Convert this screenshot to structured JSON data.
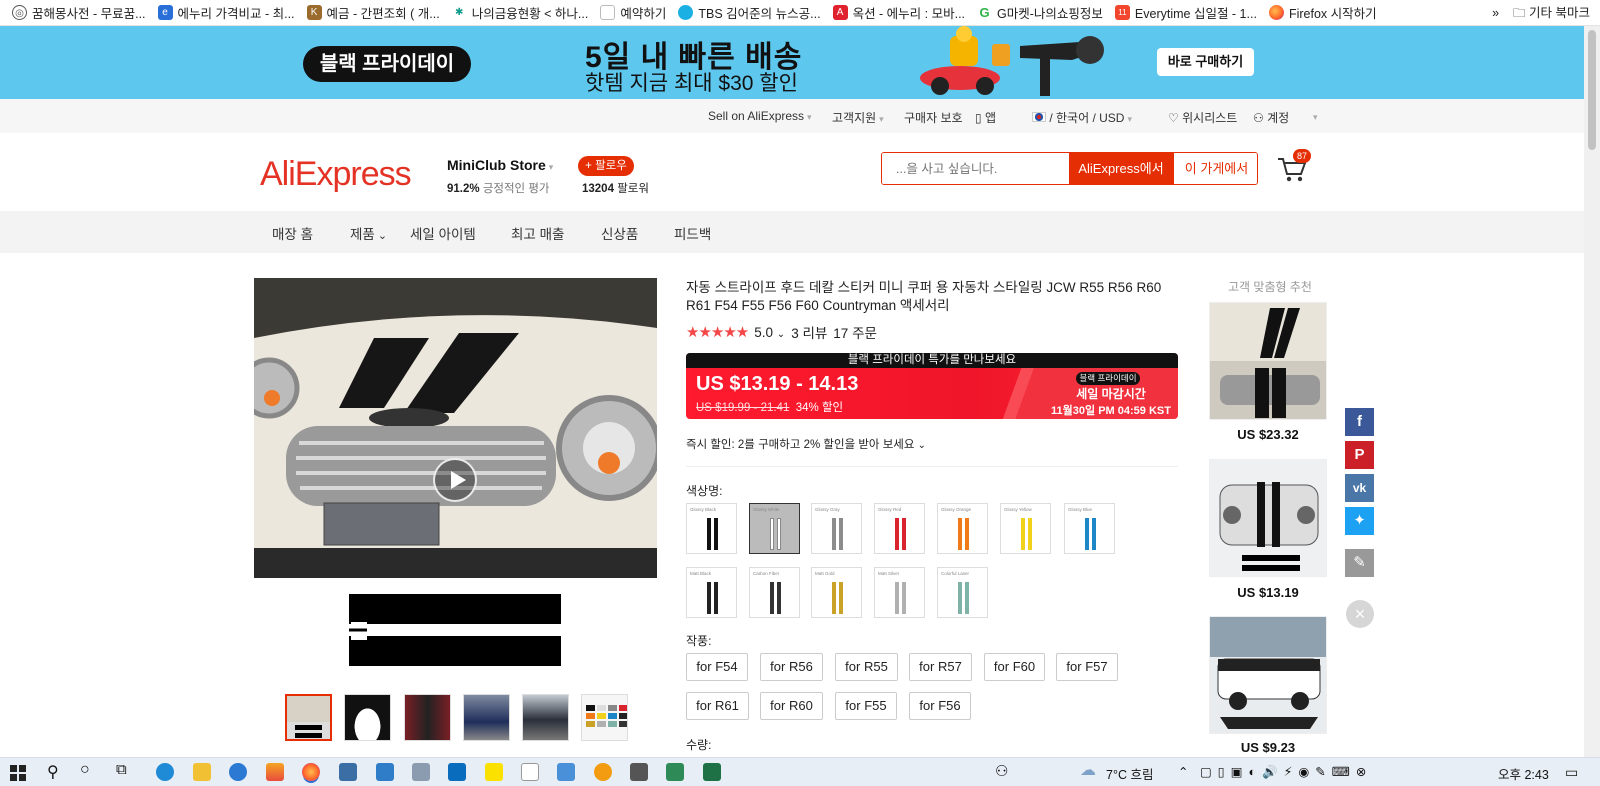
{
  "bookmarks": {
    "items": [
      {
        "label": "꿈해몽사전 - 무료꿈...",
        "icon": "globe-icon",
        "color": "#555555"
      },
      {
        "label": "에누리 가격비교 - 최...",
        "icon": "enuri-icon",
        "color": "#2a6ed8"
      },
      {
        "label": "예금 - 간편조회 ( 개...",
        "icon": "bank-icon",
        "color": "#9a6b2c"
      },
      {
        "label": "나의금융현황 < 하나...",
        "icon": "hana-icon",
        "color": "#0e9a8c"
      },
      {
        "label": "예약하기",
        "icon": "page-icon",
        "color": "#cfcfcf"
      },
      {
        "label": "TBS 김어준의 뉴스공...",
        "icon": "tbs-icon",
        "color": "#1bb0e3"
      },
      {
        "label": "옥션 - 에누리 : 모바...",
        "icon": "auction-icon",
        "color": "#e0212e"
      },
      {
        "label": "G마켓-나의쇼핑정보",
        "icon": "gmarket-icon",
        "color": "#2fb34a"
      },
      {
        "label": "Everytime 십일절 - 1...",
        "icon": "11st-icon",
        "color": "#f2462e"
      },
      {
        "label": "Firefox 시작하기",
        "icon": "firefox-icon",
        "color": "#ff6a2b"
      }
    ],
    "overflow": "»",
    "other_folder": "기타 북마크"
  },
  "banner": {
    "pill": "블랙 프라이데이",
    "headline": "5일 내 빠른 배송",
    "subline": "핫템 지금 최대 $30 할인",
    "button": "바로 구매하기"
  },
  "topnav": {
    "sell": "Sell on AliExpress",
    "support": "고객지원",
    "protection": "구매자 보호",
    "app": "앱",
    "locale": "/ 한국어 /  USD",
    "wishlist": "위시리스트",
    "account": "계정"
  },
  "header": {
    "logo": "AliExpress",
    "store_name": "MiniClub Store",
    "positive_pct": "91.2%",
    "positive_label": "긍정적인 평가",
    "follow_button": "+ 팔로우",
    "followers_count": "13204",
    "followers_label": "팔로워",
    "search_placeholder": "...을 사고 싶습니다.",
    "search_aliexpress": "AliExpress에서",
    "search_store": "이 가게에서",
    "cart_count": "87"
  },
  "storenav": {
    "items": [
      "매장 홈",
      "제품",
      "세일 아이템",
      "최고 매출",
      "신상품",
      "피드백"
    ]
  },
  "product": {
    "title": "자동 스트라이프 후드 데칼 스티커 미니 쿠퍼 용 자동차 스타일링 JCW R55 R56 R60 R61 F54 F55 F56 F60 Countryman 액세서리",
    "rating": "5.0",
    "reviews": "3 리뷰",
    "orders": "17 주문",
    "bf_banner": "블랙 프라이데이 특가를 만나보세요",
    "price": "US $13.19 - 14.13",
    "old_price": "US $19.99 - 21.41",
    "discount": "34% 할인",
    "bf_tag": "블랙 프라이데이",
    "sale_ends_label": "세일 마감시간",
    "sale_ends_time": "11월30일 PM 04:59 KST",
    "instant_discount": "즉시 할인: 2를 구매하고 2% 할인을 받아 보세요",
    "color_label": "색상명:",
    "colors": [
      {
        "name": "Glossy Black",
        "color": "#111111"
      },
      {
        "name": "Glossy White",
        "color": "#ffffff"
      },
      {
        "name": "Glossy Gray",
        "color": "#8c8c8c"
      },
      {
        "name": "Glossy Red",
        "color": "#d9232e"
      },
      {
        "name": "Glossy Orange",
        "color": "#f07a1a"
      },
      {
        "name": "Glossy Yellow",
        "color": "#f0d21c"
      },
      {
        "name": "Glossy Blue",
        "color": "#1d86c7"
      },
      {
        "name": "Matt Black",
        "color": "#222222"
      },
      {
        "name": "Carbon Fiber",
        "color": "#333333"
      },
      {
        "name": "Matt Gold",
        "color": "#c9a227"
      },
      {
        "name": "Matt Silver",
        "color": "#b0b0b0"
      },
      {
        "name": "Colorful Laser",
        "color": "#7fb3a8"
      }
    ],
    "model_label": "작풍:",
    "models": [
      "for F54",
      "for R56",
      "for R55",
      "for R57",
      "for F60",
      "for F57",
      "for R61",
      "for R60",
      "for F55",
      "for F56"
    ],
    "qty_label": "수량:"
  },
  "recommendations": {
    "title": "고객 맞춤형 추천",
    "prices": [
      "US $23.32",
      "US $13.19",
      "US $9.23"
    ]
  },
  "taskbar": {
    "weather": "7°C  흐림",
    "time": "오후 2:43"
  }
}
